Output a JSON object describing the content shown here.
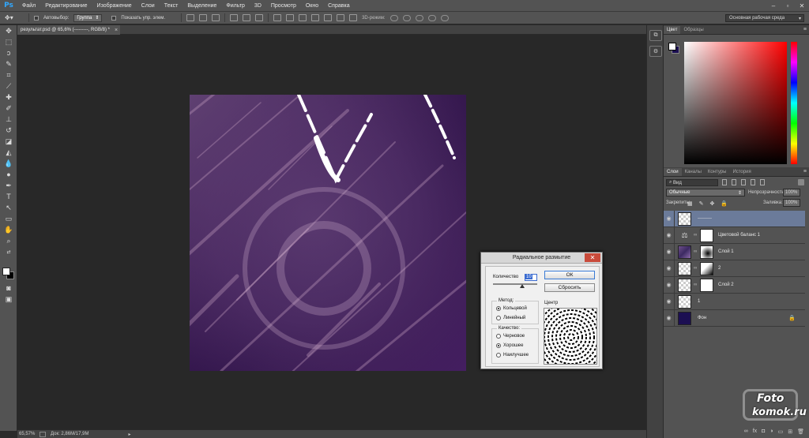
{
  "app": {
    "logo": "Ps"
  },
  "menu": [
    "Файл",
    "Редактирование",
    "Изображение",
    "Слои",
    "Текст",
    "Выделение",
    "Фильтр",
    "3D",
    "Просмотр",
    "Окно",
    "Справка"
  ],
  "options": {
    "autoselect_label": "Автовыбор:",
    "autoselect_value": "Группа",
    "show_controls_label": "Показать упр. элем.",
    "mode3d_label": "3D-режим:",
    "workspace": "Основная рабочая среда"
  },
  "document": {
    "tab_title": "результат.psd @ 65,6% (---------, RGB/8) *",
    "close": "×"
  },
  "status": {
    "zoom": "65,57%",
    "doc_info": "Док: 2,86М/17,9М"
  },
  "dialog": {
    "title": "Радиальное размытие",
    "amount_label": "Количество",
    "amount_value": "10",
    "ok_label": "ОК",
    "reset_label": "Сбросить",
    "method_title": "Метод:",
    "methods": [
      {
        "label": "Кольцевой",
        "selected": true
      },
      {
        "label": "Линейный",
        "selected": false
      }
    ],
    "quality_title": "Качество:",
    "qualities": [
      {
        "label": "Черновое",
        "selected": false
      },
      {
        "label": "Хорошее",
        "selected": true
      },
      {
        "label": "Наилучшее",
        "selected": false
      }
    ],
    "center_label": "Центр"
  },
  "color_panel": {
    "tabs": [
      "Цвет",
      "Образцы"
    ],
    "fg_color": "#ffffff",
    "bg_color": "#1c0f52"
  },
  "layers_panel": {
    "tabs": [
      "Слои",
      "Каналы",
      "Контуры",
      "История"
    ],
    "filter_label": "Вид",
    "blend_mode": "Обычные",
    "opacity_label": "Непрозрачность:",
    "opacity_value": "100%",
    "lock_label": "Закрепить:",
    "fill_label": "Заливка:",
    "fill_value": "100%",
    "layers": [
      {
        "name": "---------",
        "thumb": "transparent",
        "mask": null,
        "selected": true
      },
      {
        "name": "Цветовой баланс 1",
        "thumb": "adjustment",
        "mask": "white",
        "selected": false
      },
      {
        "name": "Слой 1",
        "thumb": "photo",
        "mask": "grad",
        "selected": false
      },
      {
        "name": "2",
        "thumb": "transparent",
        "mask": "grad2",
        "selected": false
      },
      {
        "name": "Слой 2",
        "thumb": "transparent",
        "mask": "white",
        "selected": false
      },
      {
        "name": "1",
        "thumb": "transparent",
        "mask": null,
        "selected": false
      },
      {
        "name": "Фон",
        "thumb": "navy",
        "mask": null,
        "selected": false,
        "locked": true
      }
    ]
  },
  "watermark": {
    "line1": "Foto",
    "line2": "komok.ru"
  }
}
